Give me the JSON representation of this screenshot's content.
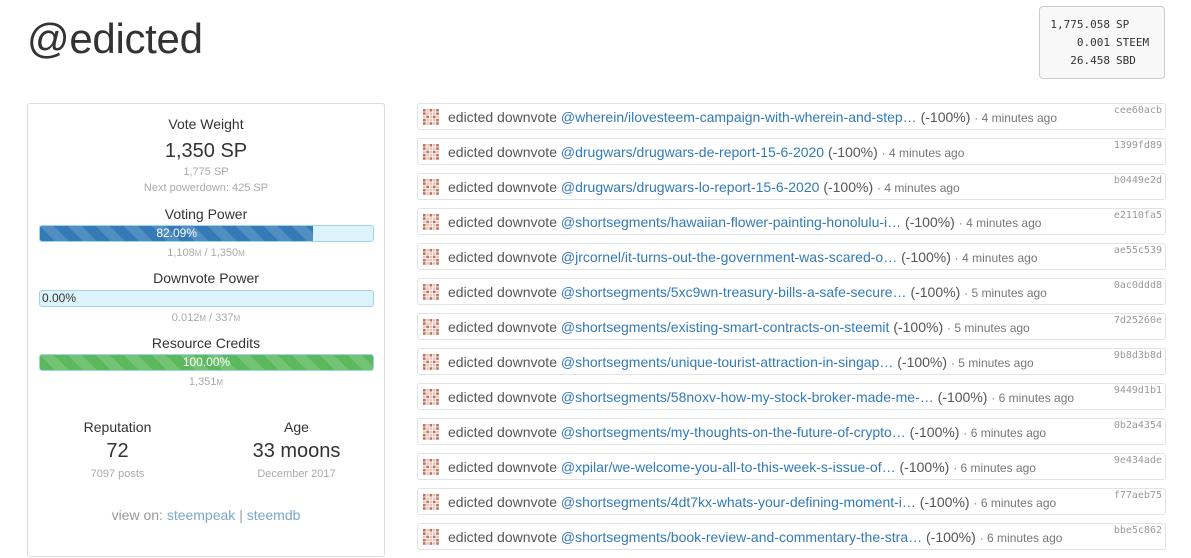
{
  "profile": {
    "username": "@edicted"
  },
  "balances": [
    {
      "amount": "1,775.058",
      "unit": "SP"
    },
    {
      "amount": "0.001",
      "unit": "STEEM"
    },
    {
      "amount": "26.458",
      "unit": "SBD"
    }
  ],
  "vote_weight": {
    "title": "Vote Weight",
    "value": "1,350 SP",
    "total": "1,775 SP",
    "next_powerdown": "Next powerdown: 425 SP"
  },
  "voting_power": {
    "title": "Voting Power",
    "percent_label": "82.09%",
    "fraction": 0.8209,
    "current": "1,108",
    "max": "1,350",
    "unit": "M"
  },
  "downvote_power": {
    "title": "Downvote Power",
    "percent_label": "0.00%",
    "fraction": 0.0,
    "current": "0.012",
    "max": "337",
    "unit": "M"
  },
  "resource_credits": {
    "title": "Resource Credits",
    "percent_label": "100.00%",
    "fraction": 1.0,
    "current": "1,351",
    "unit": "M"
  },
  "reputation": {
    "label": "Reputation",
    "value": "72",
    "caption": "7097 posts"
  },
  "age": {
    "label": "Age",
    "value": "33 moons",
    "caption": "December 2017"
  },
  "view_on": {
    "prefix": "view on:",
    "separator": "|",
    "links": [
      "steempeak",
      "steemdb"
    ]
  },
  "activity": [
    {
      "actor": "edicted",
      "action": "downvote",
      "link": "@wherein/ilovesteem-campaign-with-wherein-and-step…",
      "weight": "(-100%)",
      "time": "4 minutes ago",
      "hash": "cee60acb"
    },
    {
      "actor": "edicted",
      "action": "downvote",
      "link": "@drugwars/drugwars-de-report-15-6-2020",
      "weight": "(-100%)",
      "time": "4 minutes ago",
      "hash": "1399fd89"
    },
    {
      "actor": "edicted",
      "action": "downvote",
      "link": "@drugwars/drugwars-lo-report-15-6-2020",
      "weight": "(-100%)",
      "time": "4 minutes ago",
      "hash": "b0449e2d"
    },
    {
      "actor": "edicted",
      "action": "downvote",
      "link": "@shortsegments/hawaiian-flower-painting-honolulu-i…",
      "weight": "(-100%)",
      "time": "4 minutes ago",
      "hash": "e2110fa5"
    },
    {
      "actor": "edicted",
      "action": "downvote",
      "link": "@jrcornel/it-turns-out-the-government-was-scared-o…",
      "weight": "(-100%)",
      "time": "4 minutes ago",
      "hash": "ae55c539"
    },
    {
      "actor": "edicted",
      "action": "downvote",
      "link": "@shortsegments/5xc9wn-treasury-bills-a-safe-secure…",
      "weight": "(-100%)",
      "time": "5 minutes ago",
      "hash": "0ac0ddd8"
    },
    {
      "actor": "edicted",
      "action": "downvote",
      "link": "@shortsegments/existing-smart-contracts-on-steemit",
      "weight": "(-100%)",
      "time": "5 minutes ago",
      "hash": "7d25260e"
    },
    {
      "actor": "edicted",
      "action": "downvote",
      "link": "@shortsegments/unique-tourist-attraction-in-singap…",
      "weight": "(-100%)",
      "time": "5 minutes ago",
      "hash": "9b8d3b8d"
    },
    {
      "actor": "edicted",
      "action": "downvote",
      "link": "@shortsegments/58noxv-how-my-stock-broker-made-me-…",
      "weight": "(-100%)",
      "time": "6 minutes ago",
      "hash": "9449d1b1"
    },
    {
      "actor": "edicted",
      "action": "downvote",
      "link": "@shortsegments/my-thoughts-on-the-future-of-crypto…",
      "weight": "(-100%)",
      "time": "6 minutes ago",
      "hash": "0b2a4354"
    },
    {
      "actor": "edicted",
      "action": "downvote",
      "link": "@xpilar/we-welcome-you-all-to-this-week-s-issue-of…",
      "weight": "(-100%)",
      "time": "6 minutes ago",
      "hash": "9e434ade"
    },
    {
      "actor": "edicted",
      "action": "downvote",
      "link": "@shortsegments/4dt7kx-whats-your-defining-moment-i…",
      "weight": "(-100%)",
      "time": "6 minutes ago",
      "hash": "f77aeb75"
    },
    {
      "actor": "edicted",
      "action": "downvote",
      "link": "@shortsegments/book-review-and-commentary-the-stra…",
      "weight": "(-100%)",
      "time": "6 minutes ago",
      "hash": "bbe5c862"
    }
  ]
}
